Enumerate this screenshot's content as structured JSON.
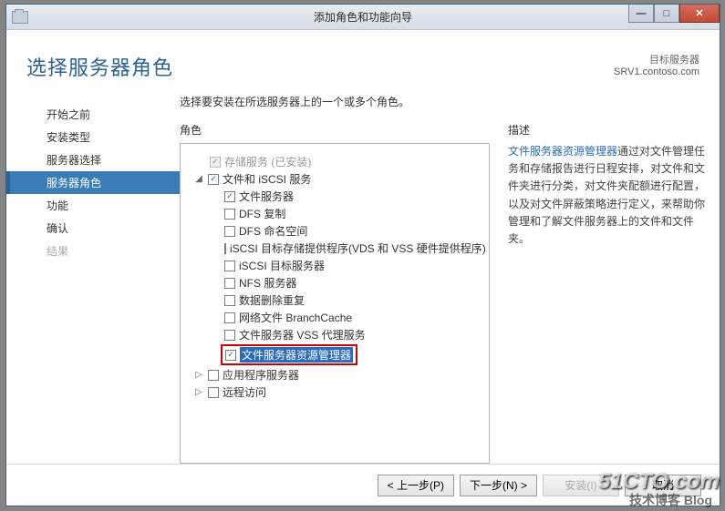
{
  "window": {
    "title": "添加角色和功能向导"
  },
  "header": {
    "title": "选择服务器角色",
    "target_label": "目标服务器",
    "target_value": "SRV1.contoso.com"
  },
  "nav": {
    "items": [
      {
        "label": "开始之前"
      },
      {
        "label": "安装类型"
      },
      {
        "label": "服务器选择"
      },
      {
        "label": "服务器角色",
        "selected": true
      },
      {
        "label": "功能"
      },
      {
        "label": "确认"
      },
      {
        "label": "结果",
        "disabled": true
      }
    ]
  },
  "main": {
    "intro": "选择要安装在所选服务器上的一个或多个角色。",
    "roles_label": "角色",
    "desc_label": "描述",
    "desc_link": "文件服务器资源管理器",
    "desc_text": "通过对文件管理任务和存储报告进行日程安排，对文件和文件夹进行分类，对文件夹配额进行配置，以及对文件屏蔽策略进行定义，来帮助你管理和了解文件服务器上的文件和文件夹。",
    "tree": {
      "storage": {
        "label": "存储服务 (已安装)"
      },
      "fileiscsi": {
        "label": "文件和 iSCSI 服务"
      },
      "fileserver": {
        "label": "文件服务器"
      },
      "dfsrep": {
        "label": "DFS 复制"
      },
      "dfsns": {
        "label": "DFS 命名空间"
      },
      "iscsiprov": {
        "label": "iSCSI 目标存储提供程序(VDS 和 VSS 硬件提供程序)"
      },
      "iscsitgt": {
        "label": "iSCSI 目标服务器"
      },
      "nfs": {
        "label": "NFS 服务器"
      },
      "dedup": {
        "label": "数据删除重复"
      },
      "branch": {
        "label": "网络文件 BranchCache"
      },
      "vss": {
        "label": "文件服务器 VSS 代理服务"
      },
      "fsrm": {
        "label": "文件服务器资源管理器"
      },
      "appserver": {
        "label": "应用程序服务器"
      },
      "remote": {
        "label": "远程访问"
      }
    }
  },
  "buttons": {
    "prev": "< 上一步(P)",
    "next": "下一步(N) >",
    "install": "安装(I)",
    "cancel": "取消"
  },
  "watermark": {
    "line1": "51CTO.com",
    "line2": "技术博客  Blog"
  }
}
